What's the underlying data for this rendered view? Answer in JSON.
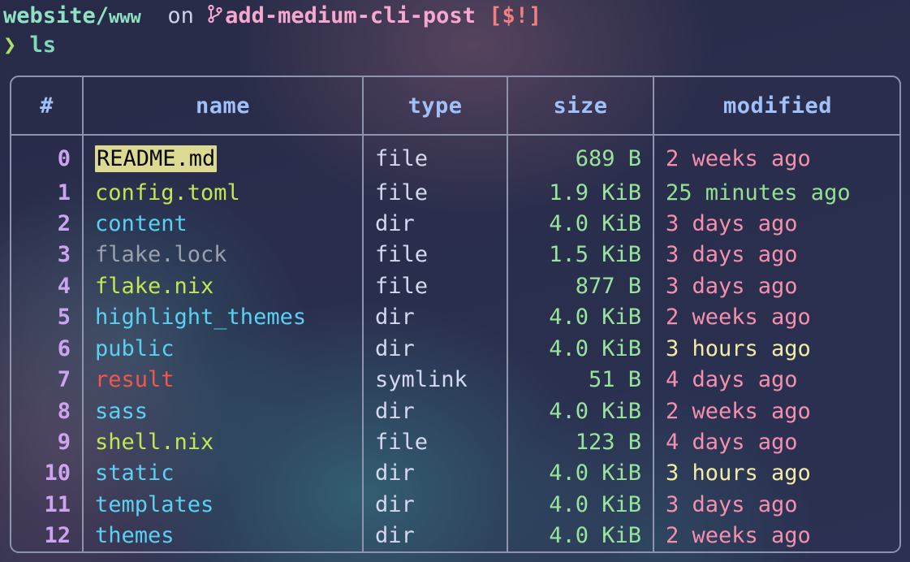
{
  "prompt": {
    "path_main": "website/",
    "path_sub": "www",
    "on_word": "on",
    "branch_icon": "git-branch-icon",
    "branch": "add-medium-cli-post",
    "git_status": "[$!]",
    "caret": "❯",
    "command": "ls"
  },
  "table": {
    "headers": [
      "#",
      "name",
      "type",
      "size",
      "modified"
    ],
    "rows": [
      {
        "idx": "0",
        "name": "README.md",
        "name_style": "selected",
        "type": "file",
        "size": "689 B",
        "modified": "2 weeks ago",
        "mod_style": "old"
      },
      {
        "idx": "1",
        "name": "config.toml",
        "name_style": "exec",
        "type": "file",
        "size": "1.9 KiB",
        "modified": "25 minutes ago",
        "mod_style": "recent"
      },
      {
        "idx": "2",
        "name": "content",
        "name_style": "dir",
        "type": "dir",
        "size": "4.0 KiB",
        "modified": "3 days ago",
        "mod_style": "old"
      },
      {
        "idx": "3",
        "name": "flake.lock",
        "name_style": "ignored",
        "type": "file",
        "size": "1.5 KiB",
        "modified": "3 days ago",
        "mod_style": "old"
      },
      {
        "idx": "4",
        "name": "flake.nix",
        "name_style": "exec",
        "type": "file",
        "size": "877 B",
        "modified": "3 days ago",
        "mod_style": "old"
      },
      {
        "idx": "5",
        "name": "highlight_themes",
        "name_style": "dir",
        "type": "dir",
        "size": "4.0 KiB",
        "modified": "2 weeks ago",
        "mod_style": "old"
      },
      {
        "idx": "6",
        "name": "public",
        "name_style": "dir",
        "type": "dir",
        "size": "4.0 KiB",
        "modified": "3 hours ago",
        "mod_style": "mid"
      },
      {
        "idx": "7",
        "name": "result",
        "name_style": "broken",
        "type": "symlink",
        "size": "51 B",
        "modified": "4 days ago",
        "mod_style": "old"
      },
      {
        "idx": "8",
        "name": "sass",
        "name_style": "dir",
        "type": "dir",
        "size": "4.0 KiB",
        "modified": "2 weeks ago",
        "mod_style": "old"
      },
      {
        "idx": "9",
        "name": "shell.nix",
        "name_style": "exec",
        "type": "file",
        "size": "123 B",
        "modified": "4 days ago",
        "mod_style": "old"
      },
      {
        "idx": "10",
        "name": "static",
        "name_style": "dir",
        "type": "dir",
        "size": "4.0 KiB",
        "modified": "3 hours ago",
        "mod_style": "mid"
      },
      {
        "idx": "11",
        "name": "templates",
        "name_style": "dir",
        "type": "dir",
        "size": "4.0 KiB",
        "modified": "3 days ago",
        "mod_style": "old"
      },
      {
        "idx": "12",
        "name": "themes",
        "name_style": "dir",
        "type": "dir",
        "size": "4.0 KiB",
        "modified": "2 weeks ago",
        "mod_style": "old"
      }
    ]
  },
  "colors": {
    "path": "#8fe3c4",
    "branch": "#f6a8d0",
    "git_status": "#f08080",
    "caret": "#a7e06a",
    "command": "#7fd9bb",
    "header": "#9fc0f8",
    "index": "#cda4f0",
    "border": "#8e93ae",
    "dir": "#5ad1f2",
    "exec": "#c3e752",
    "ignored": "#9aa0ad",
    "broken": "#f4564f",
    "type": "#d5d9ef",
    "size": "#97e59a",
    "time_old": "#f58fae",
    "time_recent": "#95e193",
    "time_mid": "#f3eda4",
    "selection_bg": "#dcd992",
    "selection_fg": "#06070a",
    "background": "#2a2e4c"
  }
}
